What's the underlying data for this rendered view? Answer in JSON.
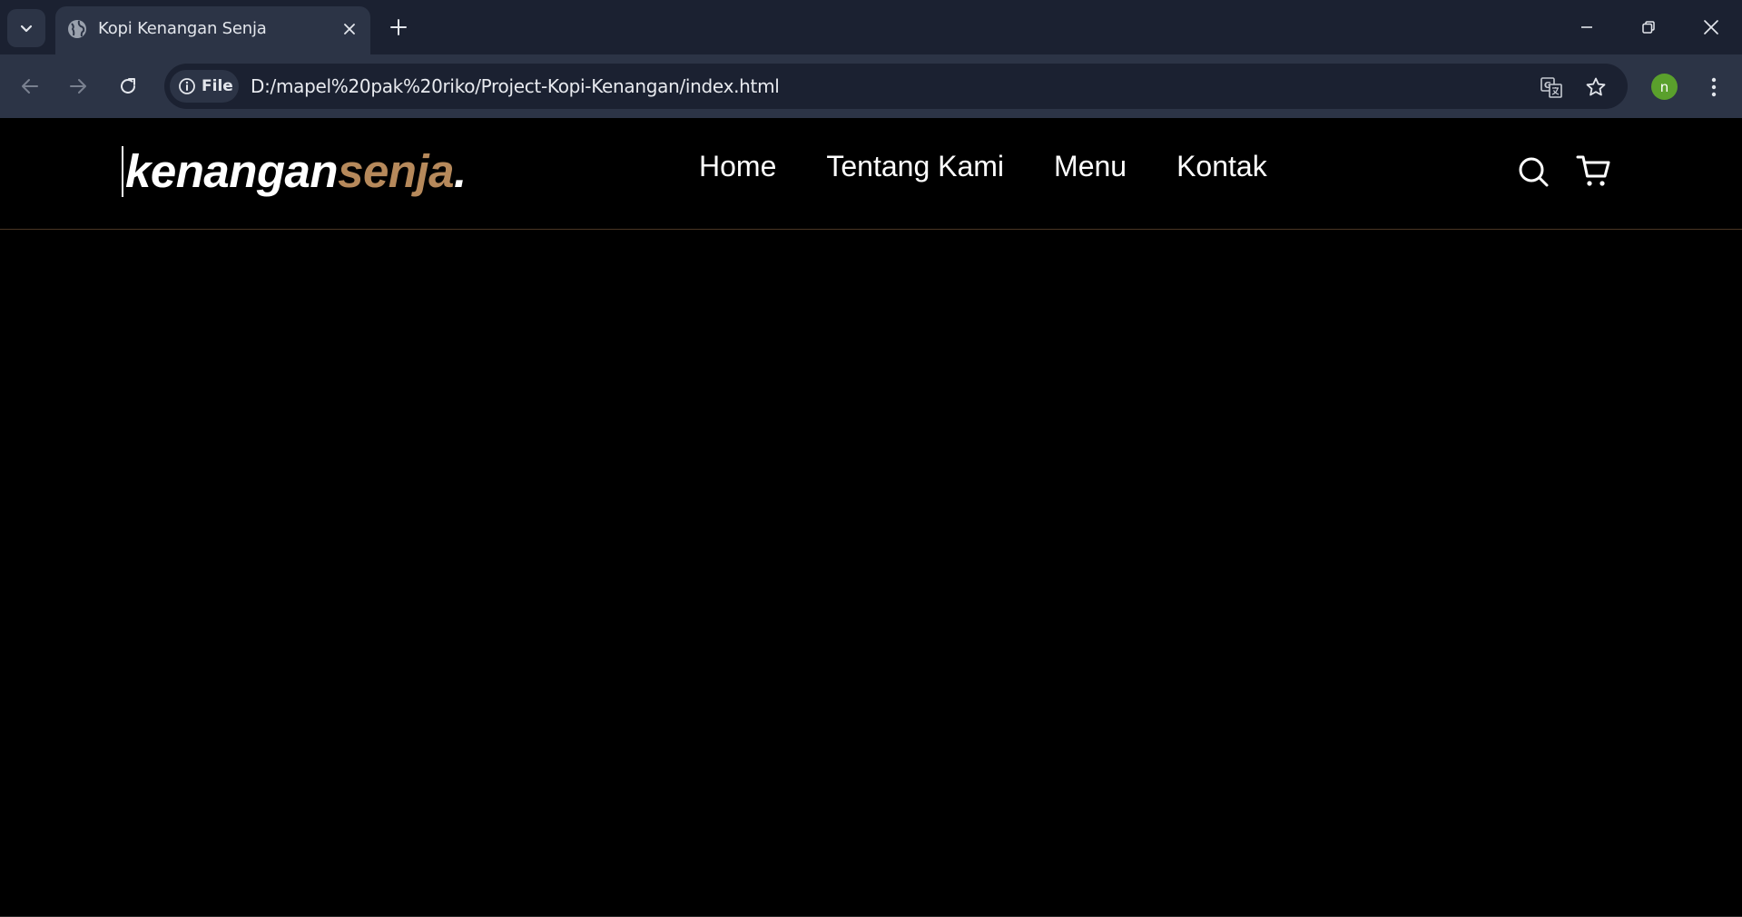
{
  "browser": {
    "tab": {
      "title": "Kopi Kenangan Senja"
    },
    "address_bar": {
      "site_chip_label": "File",
      "url": "D:/mapel%20pak%20riko/Project-Kopi-Kenangan/index.html"
    },
    "profile": {
      "initial": "n",
      "color": "#5aa02c"
    }
  },
  "site": {
    "logo": {
      "primary": "kenangan",
      "accent": "senja",
      "suffix": "."
    },
    "nav_links": [
      "Home",
      "Tentang Kami",
      "Menu",
      "Kontak"
    ],
    "colors": {
      "accent": "#b6895b",
      "background": "#000000",
      "text": "#ffffff"
    }
  }
}
